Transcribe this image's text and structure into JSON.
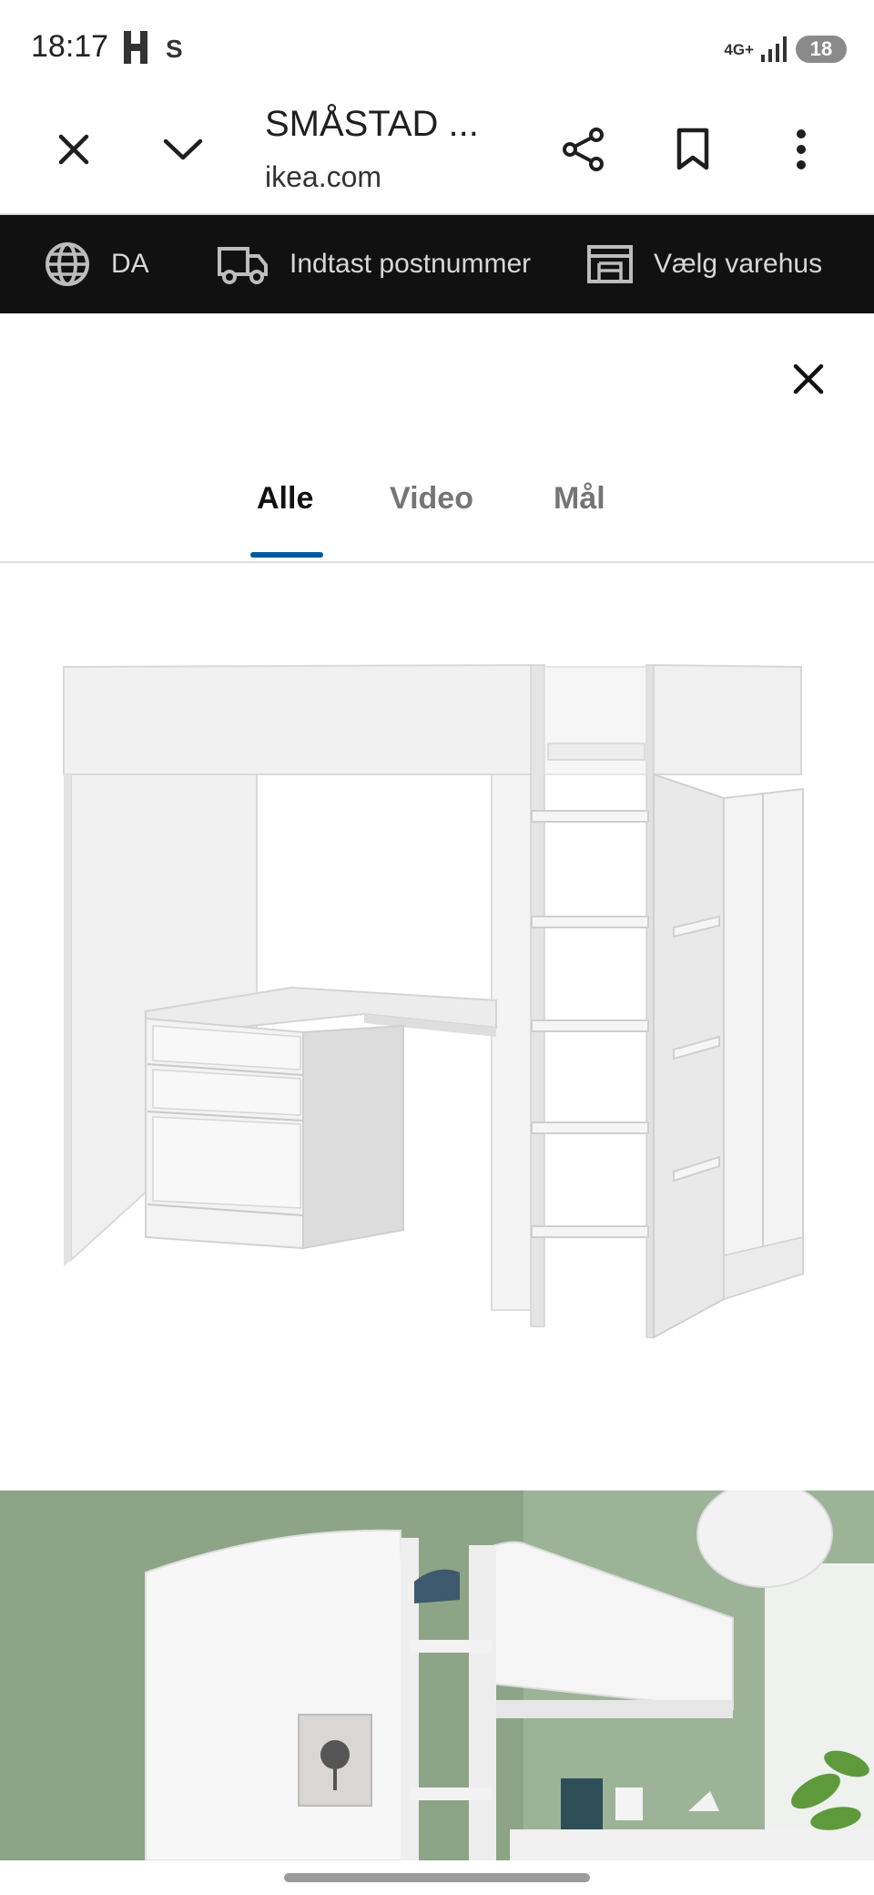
{
  "status_bar": {
    "time": "18:17",
    "app_badge": "S",
    "network": "4G+",
    "battery": "18",
    "icons": [
      "h-app-icon",
      "signal-icon",
      "battery-icon"
    ]
  },
  "browser": {
    "title": "SMÅSTAD ...",
    "domain": "ikea.com",
    "icons": [
      "close-icon",
      "chevron-down-icon",
      "share-icon",
      "bookmark-icon",
      "more-vert-icon"
    ]
  },
  "ikea_bar": {
    "language": "DA",
    "postal": "Indtast postnummer",
    "store": "Vælg varehus",
    "icons": [
      "globe-icon",
      "truck-icon",
      "store-icon"
    ]
  },
  "gallery": {
    "tabs": [
      {
        "label": "Alle",
        "active": true
      },
      {
        "label": "Video",
        "active": false
      },
      {
        "label": "Mål",
        "active": false
      }
    ],
    "icons": [
      "close-icon"
    ],
    "accent_color": "#0058a3"
  },
  "colors": {
    "ikea_bar_bg": "#111111",
    "room_wall": "#8fa588"
  }
}
